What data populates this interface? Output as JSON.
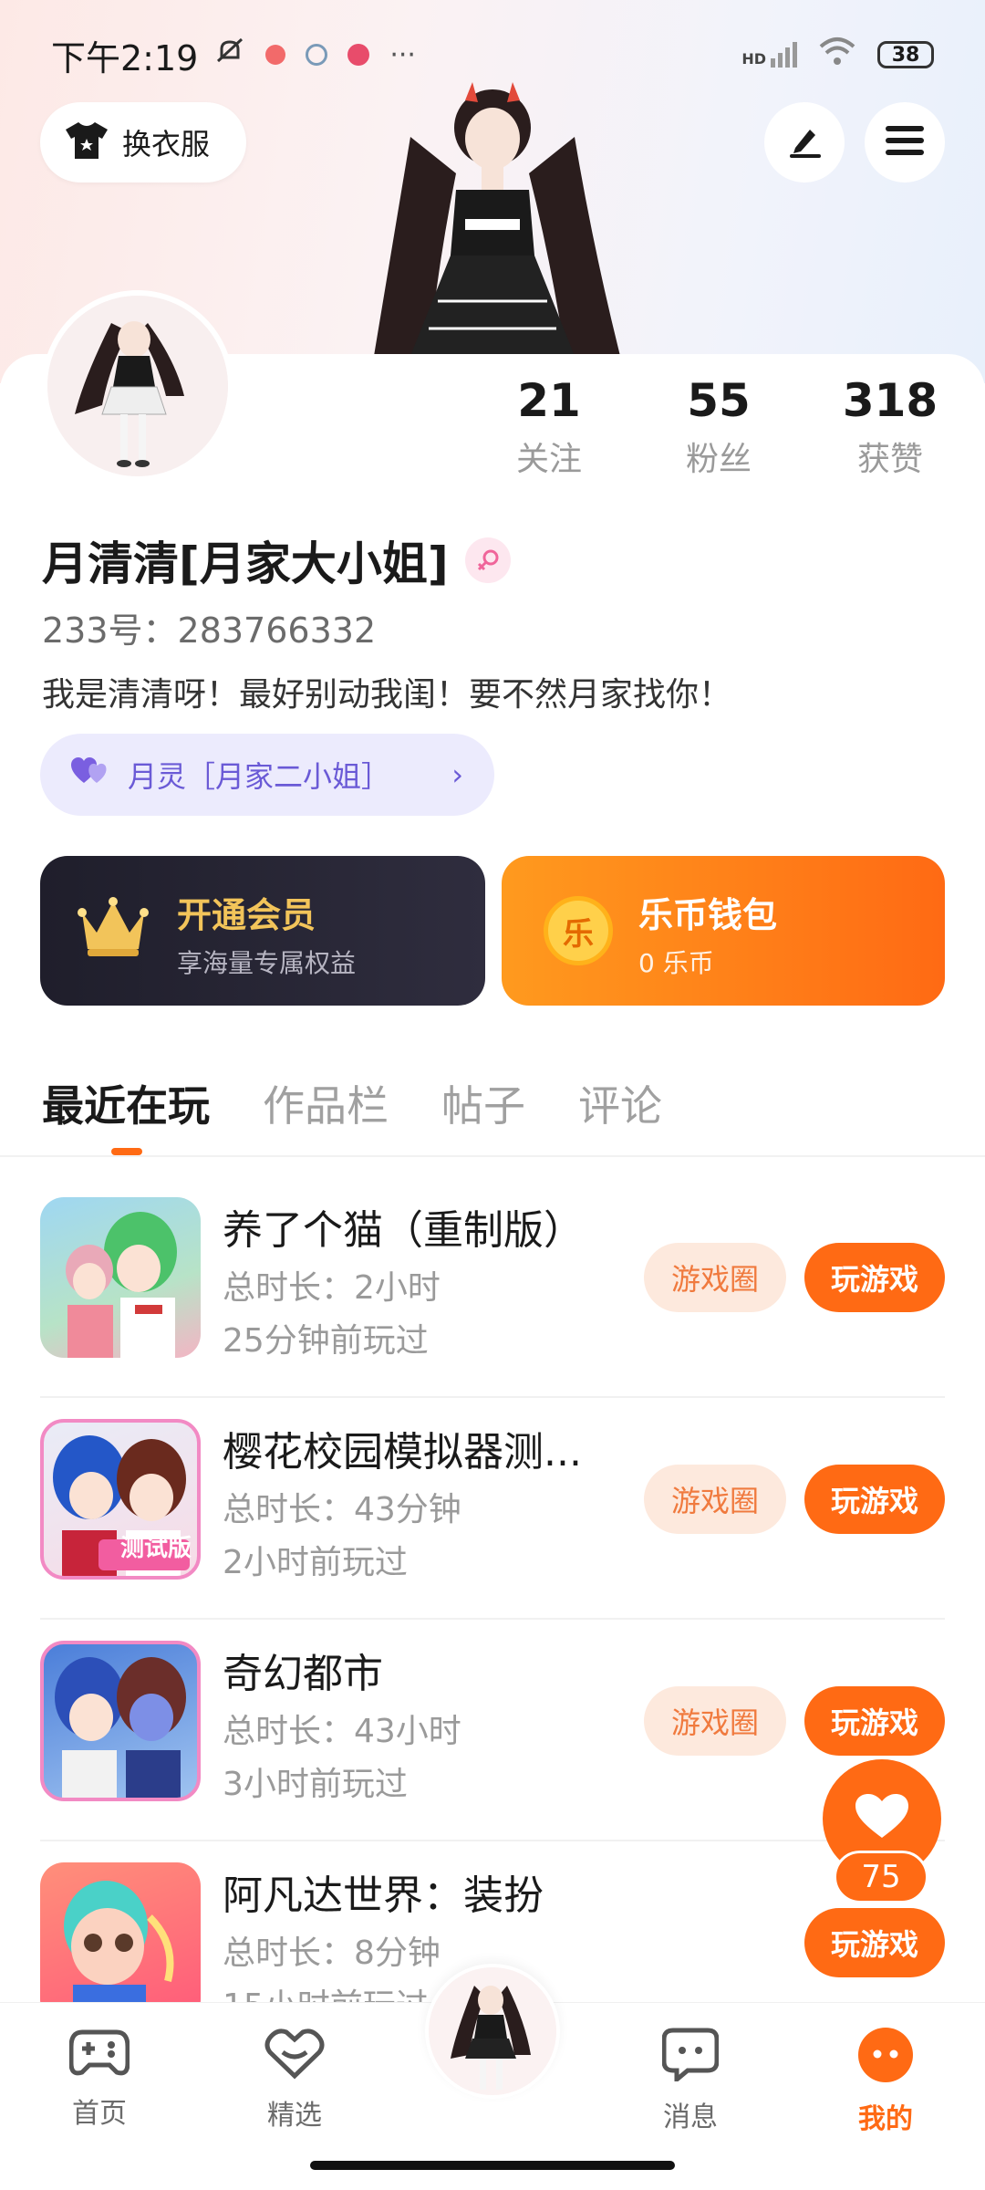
{
  "status_bar": {
    "time": "下午2:19",
    "more": "···",
    "signal": "HD",
    "battery": "38"
  },
  "header": {
    "outfit_label": "换衣服"
  },
  "profile": {
    "stats": [
      {
        "value": "21",
        "label": "关注"
      },
      {
        "value": "55",
        "label": "粉丝"
      },
      {
        "value": "318",
        "label": "获赞"
      }
    ],
    "nickname": "月清清[月家大小姐]",
    "uid": "233号：283766332",
    "bio": "我是清清呀！最好别动我闺！要不然月家找你！",
    "relation": "月灵［月家二小姐］",
    "relation_chevron": "›"
  },
  "cards": {
    "vip_title": "开通会员",
    "vip_sub": "享海量专属权益",
    "wallet_title": "乐币钱包",
    "wallet_sub": "0 乐币",
    "coin_char": "乐"
  },
  "tabs": [
    "最近在玩",
    "作品栏",
    "帖子",
    "评论"
  ],
  "games": [
    {
      "name": "养了个猫（重制版）",
      "duration": "总时长：2小时",
      "last": "25分钟前玩过",
      "circle": "游戏圈",
      "play": "玩游戏",
      "thumb_color": "#7cc7a8"
    },
    {
      "name": "樱花校园模拟器测...",
      "duration": "总时长：43分钟",
      "last": "2小时前玩过",
      "circle": "游戏圈",
      "play": "玩游戏",
      "thumb_color": "#4f6fd6",
      "badge": "测试版"
    },
    {
      "name": "奇幻都市",
      "duration": "总时长：43小时",
      "last": "3小时前玩过",
      "circle": "游戏圈",
      "play": "玩游戏",
      "thumb_color": "#5a7de0"
    },
    {
      "name": "阿凡达世界：装扮",
      "duration": "总时长：8分钟",
      "last": "15小时前玩过",
      "circle": "",
      "play": "玩游戏",
      "thumb_color": "#ff7a8a"
    }
  ],
  "floating": {
    "count": "75"
  },
  "bottom_nav": [
    {
      "label": "首页"
    },
    {
      "label": "精选"
    },
    {
      "label": "消息"
    },
    {
      "label": "我的"
    }
  ],
  "colors": {
    "accent": "#ff6a14",
    "relation_text": "#6a5ad6",
    "vip_gold": "#f2c45a"
  }
}
